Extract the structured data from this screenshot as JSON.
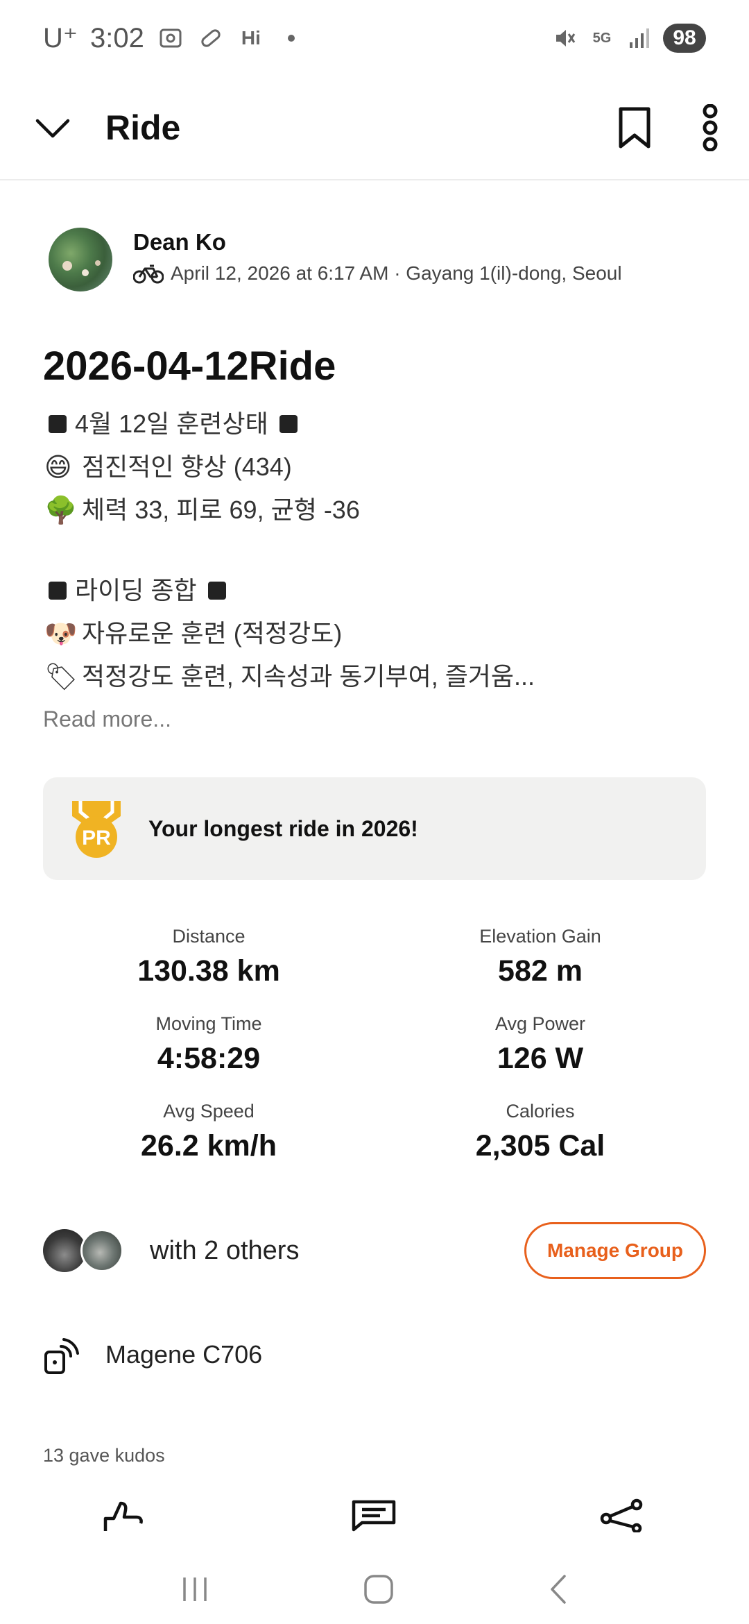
{
  "status_bar": {
    "carrier": "U⁺",
    "time": "3:02",
    "hi_label": "Hi",
    "network_label": "5G",
    "battery": "98"
  },
  "app_bar": {
    "title": "Ride"
  },
  "author": {
    "name": "Dean Ko",
    "meta": "April 12, 2026 at 6:17 AM · Gayang 1(il)-dong, Seoul"
  },
  "activity": {
    "title": "2026-04-12Ride",
    "description": {
      "line1": "4월 12일 훈련상태",
      "line2": "점진적인 향상 (434)",
      "line3": "체력 33, 피로 69, 균형 -36",
      "line4": "라이딩 종합",
      "line5": "자유로운 훈련 (적정강도)",
      "line6": "적정강도 훈련, 지속성과 동기부여, 즐거움..."
    },
    "read_more": "Read more..."
  },
  "pr_banner": {
    "badge": "PR",
    "text": "Your longest ride in 2026!",
    "accent": "#f0b323"
  },
  "stats": {
    "distance_label": "Distance",
    "distance_value": "130.38 km",
    "elevation_label": "Elevation Gain",
    "elevation_value": "582 m",
    "moving_time_label": "Moving Time",
    "moving_time_value": "4:58:29",
    "avg_power_label": "Avg Power",
    "avg_power_value": "126 W",
    "avg_speed_label": "Avg Speed",
    "avg_speed_value": "26.2 km/h",
    "calories_label": "Calories",
    "calories_value": "2,305 Cal"
  },
  "group": {
    "text": "with 2 others",
    "button": "Manage Group",
    "accent": "#e8601c"
  },
  "device": {
    "name": "Magene C706"
  },
  "kudos": {
    "text": "13 gave kudos"
  },
  "icons": {
    "back": "chevron-down-icon",
    "bookmark": "bookmark-icon",
    "more": "more-vertical-icon",
    "kudos": "thumbs-up-icon",
    "comment": "comment-icon",
    "share": "share-icon"
  }
}
